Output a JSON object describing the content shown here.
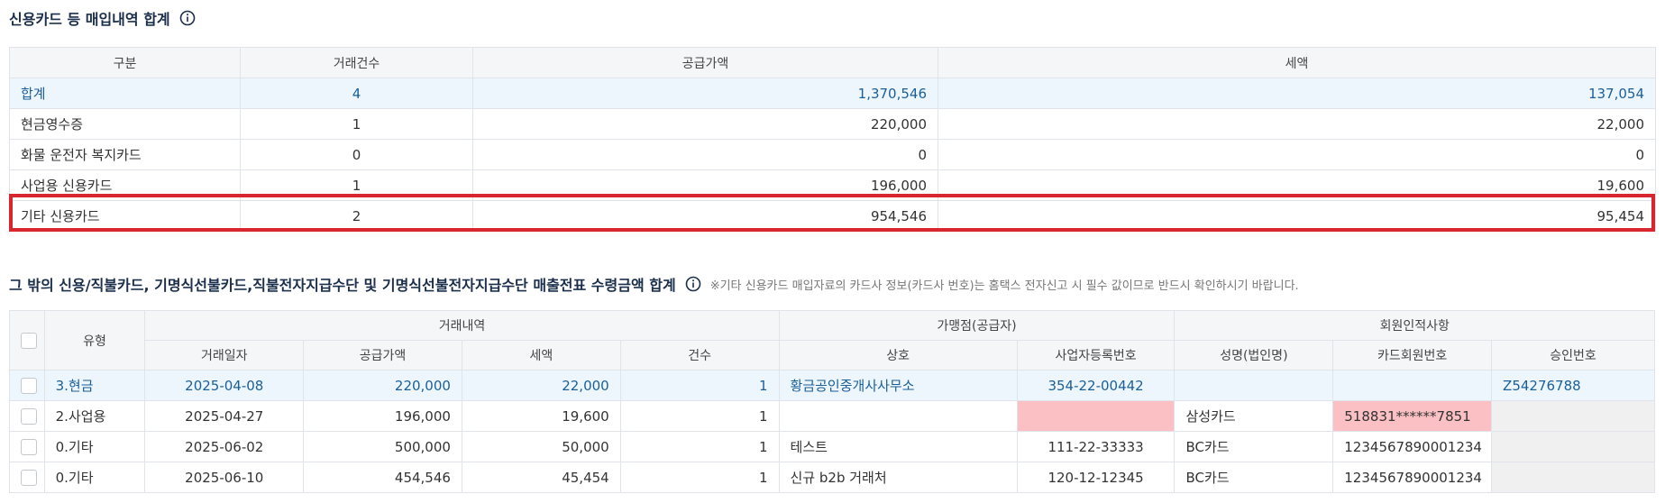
{
  "section1": {
    "title": "신용카드 등 매입내역 합계",
    "headers": [
      "구분",
      "거래건수",
      "공급가액",
      "세액"
    ],
    "rows": [
      {
        "label": "합계",
        "count": "4",
        "supply": "1,370,546",
        "tax": "137,054"
      },
      {
        "label": "현금영수증",
        "count": "1",
        "supply": "220,000",
        "tax": "22,000"
      },
      {
        "label": "화물 운전자 복지카드",
        "count": "0",
        "supply": "0",
        "tax": "0"
      },
      {
        "label": "사업용 신용카드",
        "count": "1",
        "supply": "196,000",
        "tax": "19,600"
      },
      {
        "label": "기타 신용카드",
        "count": "2",
        "supply": "954,546",
        "tax": "95,454"
      }
    ]
  },
  "section2": {
    "title": "그 밖의 신용/직불카드, 기명식선불카드,직불전자지급수단 및 기명식선불전자지급수단 매출전표 수령금액 합계",
    "notice": "※기타 신용카드 매입자료의 카드사 정보(카드사 번호)는 홈택스 전자신고 시 필수 값이므로 반드시 확인하시기 바랍니다.",
    "group_headers": {
      "type": "유형",
      "transactions": "거래내역",
      "merchant": "가맹점(공급자)",
      "member": "회원인적사항"
    },
    "sub_headers": {
      "date": "거래일자",
      "supply": "공급가액",
      "tax": "세액",
      "count": "건수",
      "name": "상호",
      "biz_no": "사업자등록번호",
      "owner": "성명(법인명)",
      "card_no": "카드회원번호",
      "approval": "승인번호"
    },
    "rows": [
      {
        "type": "3.현금",
        "date": "2025-04-08",
        "supply": "220,000",
        "tax": "22,000",
        "count": "1",
        "name": "황금공인중개사사무소",
        "biz_no": "354-22-00442",
        "owner": "",
        "card_no": "",
        "approval": "Z54276788"
      },
      {
        "type": "2.사업용",
        "date": "2025-04-27",
        "supply": "196,000",
        "tax": "19,600",
        "count": "1",
        "name": "",
        "biz_no": "",
        "owner": "삼성카드",
        "card_no": "518831******7851",
        "approval": ""
      },
      {
        "type": "0.기타",
        "date": "2025-06-02",
        "supply": "500,000",
        "tax": "50,000",
        "count": "1",
        "name": "테스트",
        "biz_no": "111-22-33333",
        "owner": "BC카드",
        "card_no": "1234567890001234",
        "approval": ""
      },
      {
        "type": "0.기타",
        "date": "2025-06-10",
        "supply": "454,546",
        "tax": "45,454",
        "count": "1",
        "name": "신규 b2b 거래처",
        "biz_no": "120-12-12345",
        "owner": "BC카드",
        "card_no": "1234567890001234",
        "approval": ""
      }
    ]
  },
  "colors": {
    "accent": "#1a5f99",
    "highlight": "#d8262f",
    "error_cell": "#fbc0c3"
  },
  "icons": {
    "info": "info-circle-icon",
    "checkbox": "checkbox-icon"
  }
}
